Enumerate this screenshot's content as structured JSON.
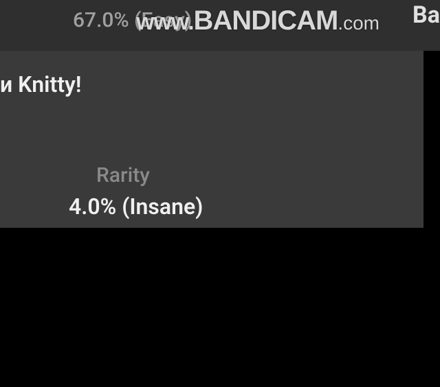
{
  "top_text": "67.0% (Easy)",
  "back_label": "Back",
  "watermark": {
    "prefix": "www.",
    "brand": "BANDICAM",
    "suffix": ".com"
  },
  "subtitle": "и Knitty!",
  "rarity": {
    "label": "Rarity",
    "value": "4.0% (Insane)"
  }
}
